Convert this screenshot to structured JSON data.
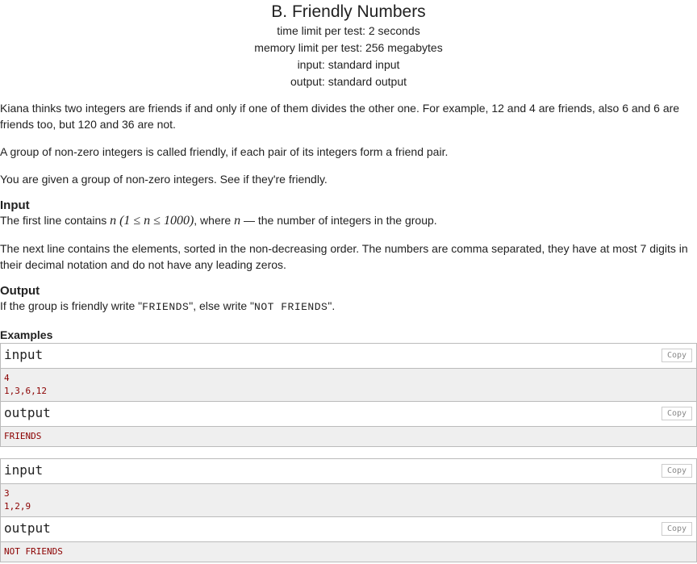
{
  "problem": {
    "title": "B. Friendly Numbers",
    "time_limit": "time limit per test: 2 seconds",
    "memory_limit": "memory limit per test: 256 megabytes",
    "input": "input: standard input",
    "output": "output: standard output"
  },
  "statement": {
    "p1": "Kiana thinks two integers are friends if and only if one of them divides the other one. For example, 12 and 4 are friends, also 6 and 6 are friends too, but 120 and 36 are not.",
    "p2": "A group of non-zero integers is called friendly, if each pair of its integers form a friend pair.",
    "p3": "You are given a group of non-zero integers. See if they're friendly."
  },
  "input_section": {
    "title": "Input",
    "line1_before": "The first line contains ",
    "line1_var": "n",
    "line1_math": "(1 ≤ n ≤ 1000)",
    "line1_mid": ", where ",
    "line1_var2": "n",
    "line1_after": " — the number of integers in the group.",
    "p2": "The next line contains the elements, sorted in the non-decreasing order. The numbers are comma separated, they have at most 7 digits in their decimal notation and do not have any leading zeros."
  },
  "output_section": {
    "title": "Output",
    "before": "If the group is friendly write \"",
    "code1": "FRIENDS",
    "mid": "\", else write \"",
    "code2": "NOT FRIENDS",
    "after": "\"."
  },
  "examples": {
    "title": "Examples",
    "input_label": "input",
    "output_label": "output",
    "copy_label": "Copy",
    "ex1": {
      "input_lines": [
        "4",
        "1,3,6,12"
      ],
      "output_lines": [
        "FRIENDS"
      ]
    },
    "ex2": {
      "input_lines": [
        "3",
        "1,2,9"
      ],
      "output_lines": [
        "NOT FRIENDS"
      ]
    }
  }
}
